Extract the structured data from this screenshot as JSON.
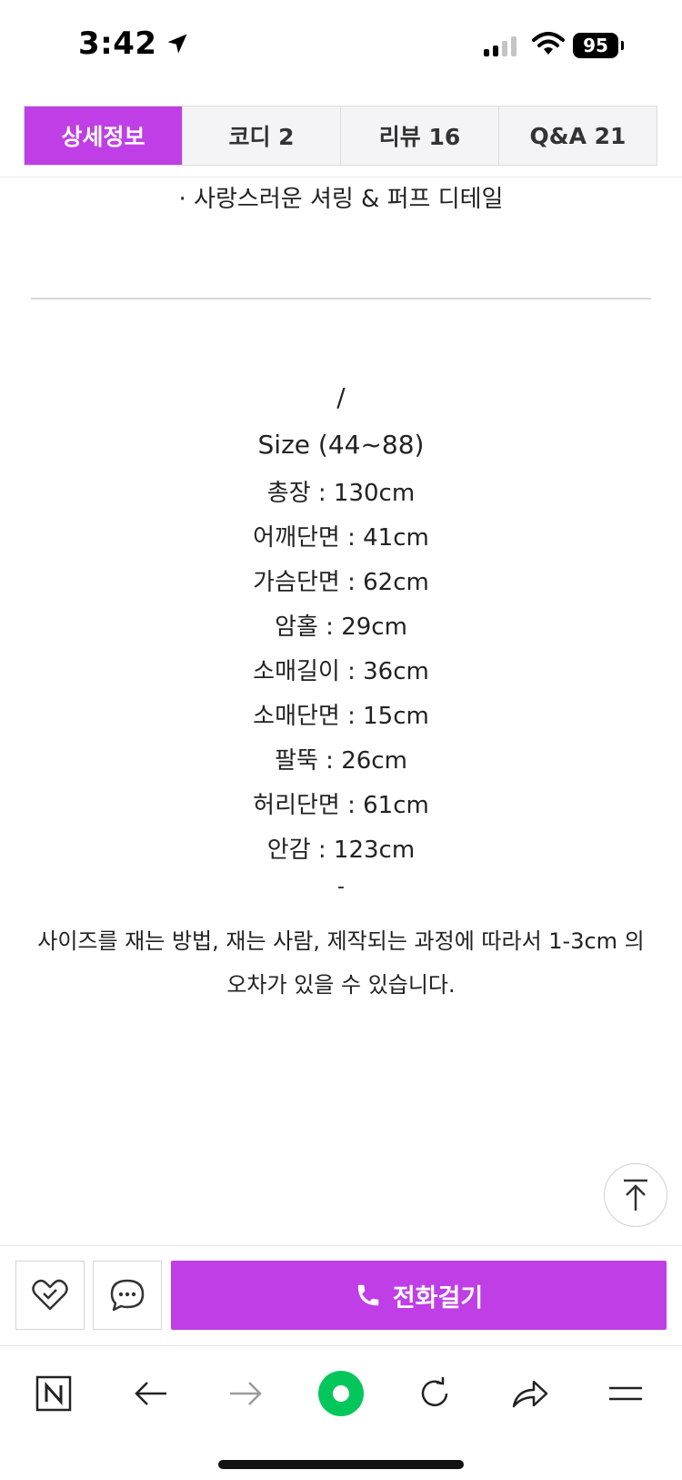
{
  "status": {
    "time": "3:42",
    "battery": "95"
  },
  "tabs": [
    {
      "label": "상세정보",
      "active": true
    },
    {
      "label": "코디 2",
      "active": false
    },
    {
      "label": "리뷰 16",
      "active": false
    },
    {
      "label": "Q&A 21",
      "active": false
    }
  ],
  "content": {
    "feature_line": "· 사랑스러운 셔링 & 퍼프 디테일",
    "slash": "/",
    "size_title": "Size (44~88)",
    "specs": [
      "총장 : 130cm",
      "어깨단면 : 41cm",
      "가슴단면 : 62cm",
      "암홀 : 29cm",
      "소매길이 : 36cm",
      "소매단면 : 15cm",
      "팔뚝 : 26cm",
      "허리단면 : 61cm",
      "안감 : 123cm"
    ],
    "dash": "-",
    "note": "사이즈를 재는 방법, 재는 사람, 제작되는 과정에 따라서 1-3cm 의 오차가 있을 수 있습니다."
  },
  "action_bar": {
    "call_label": "전화걸기"
  },
  "colors": {
    "accent": "#c03ee6",
    "naver_green": "#03c75a"
  },
  "icons": {
    "like": "heart-check-icon",
    "chat": "chat-bubble-icon",
    "call": "phone-icon",
    "top": "arrow-up-icon",
    "browser": [
      "naver-n-icon",
      "back-arrow-icon",
      "forward-arrow-icon",
      "green-dot-icon",
      "refresh-icon",
      "share-icon",
      "menu-icon"
    ]
  }
}
